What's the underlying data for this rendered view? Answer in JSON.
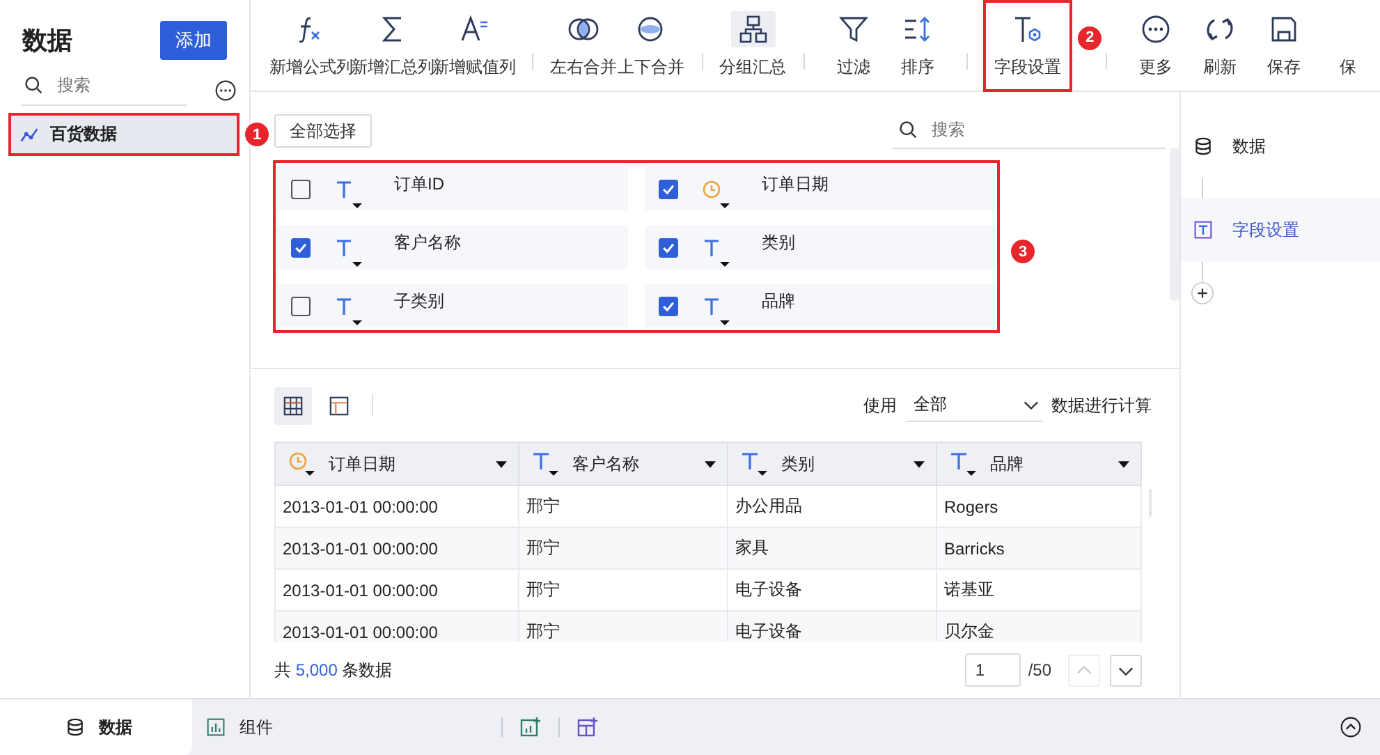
{
  "sidebar": {
    "title": "数据",
    "add_button": "添加",
    "search": {
      "placeholder": "搜索"
    },
    "items": [
      {
        "label": "百货数据",
        "selected": true,
        "highlighted": true,
        "callout": "1"
      }
    ]
  },
  "toolbar": {
    "items": [
      {
        "kind": "button",
        "label": "新增公式列",
        "selected": false,
        "highlighted": false
      },
      {
        "kind": "button",
        "label": "新增汇总列",
        "selected": false,
        "highlighted": false
      },
      {
        "kind": "button",
        "label": "新增赋值列",
        "selected": false,
        "highlighted": false
      },
      {
        "kind": "separator"
      },
      {
        "kind": "button",
        "label": "左右合并",
        "selected": false,
        "highlighted": false
      },
      {
        "kind": "button",
        "label": "上下合并",
        "selected": false,
        "highlighted": false
      },
      {
        "kind": "separator"
      },
      {
        "kind": "button",
        "label": "分组汇总",
        "selected": true,
        "highlighted": false
      },
      {
        "kind": "separator"
      },
      {
        "kind": "button",
        "label": "过滤",
        "selected": false,
        "highlighted": false
      },
      {
        "kind": "button",
        "label": "排序",
        "selected": false,
        "highlighted": false
      },
      {
        "kind": "separator"
      },
      {
        "kind": "button",
        "label": "字段设置",
        "selected": false,
        "highlighted": true,
        "callout": "2"
      },
      {
        "kind": "separator"
      },
      {
        "kind": "button",
        "label": "更多",
        "selected": false,
        "highlighted": false
      },
      {
        "kind": "button",
        "label": "刷新",
        "selected": false,
        "highlighted": false
      },
      {
        "kind": "button",
        "label": "保存",
        "selected": false,
        "highlighted": false
      },
      {
        "kind": "button",
        "label": "保",
        "selected": false,
        "highlighted": false
      }
    ]
  },
  "fields": {
    "select_all_button": "全部选择",
    "search": {
      "placeholder": "搜索"
    },
    "highlighted": true,
    "callout": "3",
    "items": [
      {
        "name": "订单ID",
        "kind": "text",
        "checked": false
      },
      {
        "name": "订单日期",
        "kind": "date",
        "checked": true
      },
      {
        "name": "客户名称",
        "kind": "text",
        "checked": true
      },
      {
        "name": "类别",
        "kind": "text",
        "checked": true
      },
      {
        "name": "子类别",
        "kind": "text",
        "checked": false
      },
      {
        "name": "品牌",
        "kind": "text",
        "checked": true
      }
    ]
  },
  "preview": {
    "view_buttons": [
      {
        "selected": true
      },
      {
        "selected": false
      }
    ],
    "use_label": "使用",
    "scope": "全部",
    "suffix": "数据进行计算",
    "table": {
      "columns": [
        {
          "label": "订单日期",
          "kind": "date"
        },
        {
          "label": "客户名称",
          "kind": "text"
        },
        {
          "label": "类别",
          "kind": "text"
        },
        {
          "label": "品牌",
          "kind": "text"
        }
      ],
      "rows": [
        [
          "2013-01-01 00:00:00",
          "邢宁",
          "办公用品",
          "Rogers"
        ],
        [
          "2013-01-01 00:00:00",
          "邢宁",
          "家具",
          "Barricks"
        ],
        [
          "2013-01-01 00:00:00",
          "邢宁",
          "电子设备",
          "诺基亚"
        ],
        [
          "2013-01-01 00:00:00",
          "邢宁",
          "电子设备",
          "贝尔金"
        ]
      ]
    },
    "footer": {
      "total_prefix": "共",
      "total": "5,000",
      "total_suffix": "条数据",
      "page": "1",
      "pages": "/50",
      "up_disabled": true,
      "down_disabled": false
    }
  },
  "steps": [
    {
      "label": "数据",
      "selected": false
    },
    {
      "label": "字段设置",
      "selected": true
    }
  ],
  "bottom_tabs": [
    {
      "label": "数据",
      "selected": true
    },
    {
      "label": "组件",
      "selected": false
    }
  ]
}
